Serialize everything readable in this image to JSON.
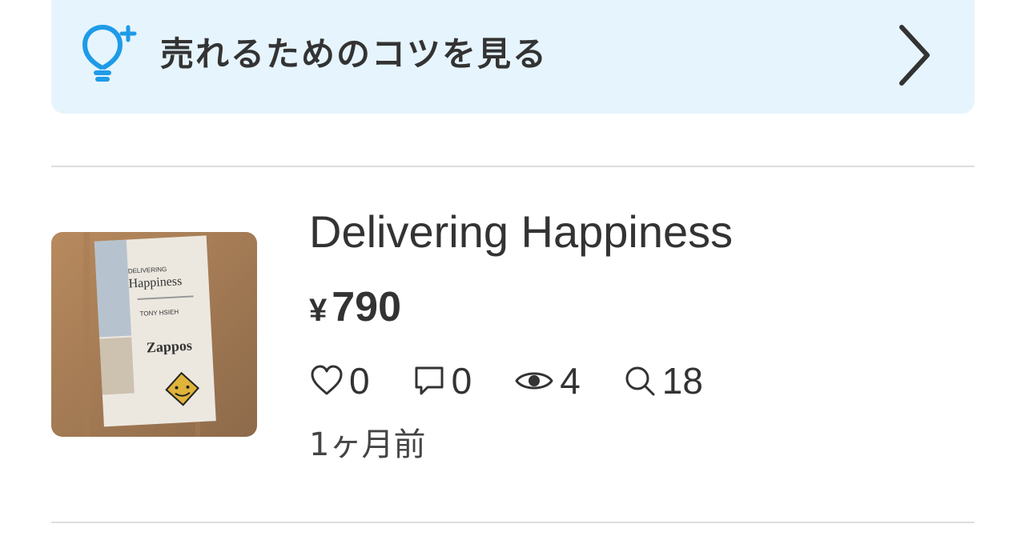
{
  "tips_banner": {
    "label": "売れるためのコツを見る",
    "icon": "lightbulb-plus-icon",
    "accent_color": "#1e9be8"
  },
  "listing": {
    "title": "Delivering Happiness",
    "currency_symbol": "¥",
    "price": "790",
    "stats": {
      "likes": "0",
      "comments": "0",
      "views": "4",
      "searches": "18"
    },
    "time_ago": "1ヶ月前",
    "thumbnail": {
      "book_title": "Happiness",
      "book_subtitle": "DELIVERING",
      "author": "TONY HSIEH",
      "brand": "Zappos"
    }
  }
}
